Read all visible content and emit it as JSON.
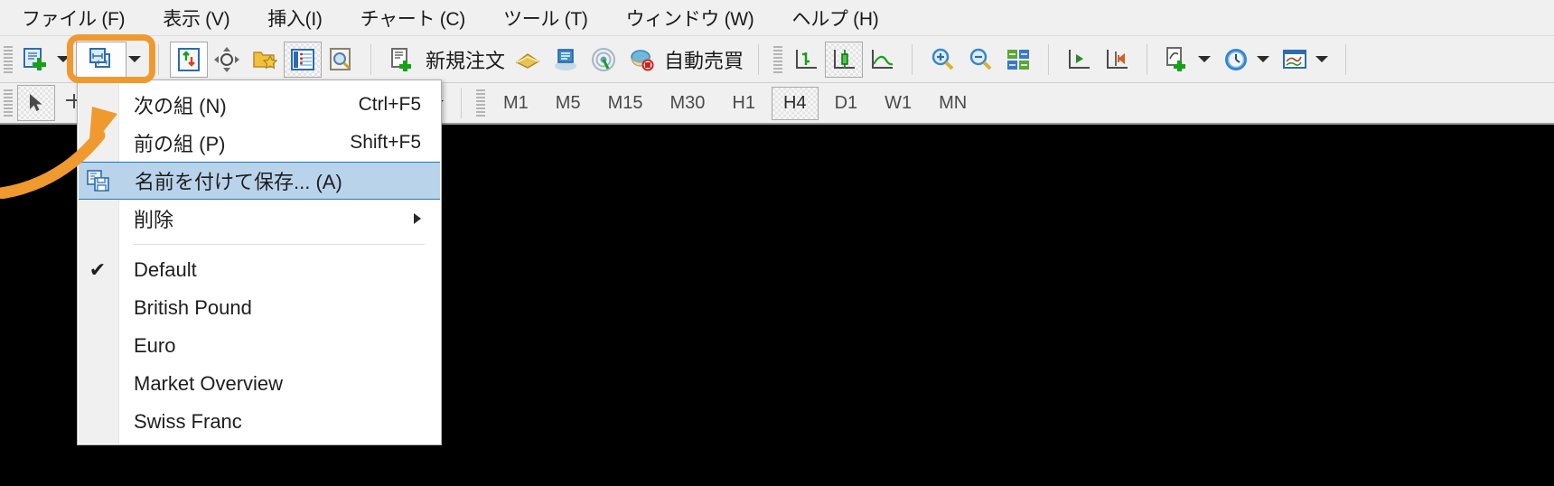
{
  "app": {
    "title": "MetaTrader 4 terminal",
    "accent_color": "#f0992e",
    "menu_highlight_color": "#b9d4ea",
    "chart_background": "#000000",
    "toolbar_background": "#f0f0f0"
  },
  "menubar": {
    "items": [
      {
        "label": "ファイル (F)",
        "name": "menu-file"
      },
      {
        "label": "表示 (V)",
        "name": "menu-view"
      },
      {
        "label": "挿入(I)",
        "name": "menu-insert"
      },
      {
        "label": "チャート (C)",
        "name": "menu-chart"
      },
      {
        "label": "ツール (T)",
        "name": "menu-tools"
      },
      {
        "label": "ウィンドウ (W)",
        "name": "menu-window"
      },
      {
        "label": "ヘルプ (H)",
        "name": "menu-help"
      }
    ]
  },
  "toolbar_main": {
    "buttons": [
      {
        "icon": "new-chart-icon",
        "label": "",
        "dropdown": true
      },
      {
        "icon": "profiles-icon",
        "label": "",
        "dropdown": true,
        "highlighted": true
      },
      {
        "icon": "market-watch-icon",
        "label": ""
      },
      {
        "icon": "crosshair-icon",
        "label": ""
      },
      {
        "icon": "navigator-folder-icon",
        "label": ""
      },
      {
        "icon": "data-window-icon",
        "label": ""
      },
      {
        "icon": "terminal-icon",
        "label": ""
      },
      {
        "icon": "new-order-icon",
        "label": "新規注文"
      },
      {
        "icon": "metaeditor-icon",
        "label": ""
      },
      {
        "icon": "strategy-tester-icon",
        "label": ""
      },
      {
        "icon": "signals-icon",
        "label": ""
      },
      {
        "icon": "autotrading-icon",
        "label": "自動売買"
      },
      {
        "icon": "bar-chart-icon",
        "label": ""
      },
      {
        "icon": "candlestick-chart-icon",
        "label": "",
        "pressed": true
      },
      {
        "icon": "line-chart-icon",
        "label": ""
      },
      {
        "icon": "zoom-in-icon",
        "label": ""
      },
      {
        "icon": "zoom-out-icon",
        "label": ""
      },
      {
        "icon": "tile-windows-icon",
        "label": ""
      },
      {
        "icon": "auto-scroll-icon",
        "label": ""
      },
      {
        "icon": "chart-shift-icon",
        "label": ""
      },
      {
        "icon": "indicators-icon",
        "label": "",
        "dropdown": true
      },
      {
        "icon": "timeframes-clock-icon",
        "label": "",
        "dropdown": true
      },
      {
        "icon": "templates-icon",
        "label": "",
        "dropdown": true
      }
    ]
  },
  "toolbar_secondary": {
    "cursor_button": {
      "icon": "arrow-cursor-icon",
      "pressed": true
    },
    "crosshair_button": {
      "icon": "crosshair-line-icon"
    },
    "objects_button": {
      "icon": "objects-icon",
      "dropdown": true
    },
    "timeframes": [
      {
        "label": "M1",
        "active": false
      },
      {
        "label": "M5",
        "active": false
      },
      {
        "label": "M15",
        "active": false
      },
      {
        "label": "M30",
        "active": false
      },
      {
        "label": "H1",
        "active": false
      },
      {
        "label": "H4",
        "active": true
      },
      {
        "label": "D1",
        "active": false
      },
      {
        "label": "W1",
        "active": false
      },
      {
        "label": "MN",
        "active": false
      }
    ]
  },
  "dropdown_menu": {
    "name": "profiles-dropdown",
    "items": [
      {
        "type": "item",
        "label": "次の組 (N)",
        "accel": "Ctrl+F5",
        "icon": null,
        "checked": false,
        "selected": false,
        "submenu": false
      },
      {
        "type": "item",
        "label": "前の組 (P)",
        "accel": "Shift+F5",
        "icon": null,
        "checked": false,
        "selected": false,
        "submenu": false
      },
      {
        "type": "item",
        "label": "名前を付けて保存... (A)",
        "accel": "",
        "icon": "save-as-icon",
        "checked": false,
        "selected": true,
        "submenu": false
      },
      {
        "type": "item",
        "label": "削除",
        "accel": "",
        "icon": null,
        "checked": false,
        "selected": false,
        "submenu": true
      },
      {
        "type": "separator"
      },
      {
        "type": "item",
        "label": "Default",
        "accel": "",
        "icon": null,
        "checked": true,
        "selected": false,
        "submenu": false
      },
      {
        "type": "item",
        "label": "British Pound",
        "accel": "",
        "icon": null,
        "checked": false,
        "selected": false,
        "submenu": false
      },
      {
        "type": "item",
        "label": "Euro",
        "accel": "",
        "icon": null,
        "checked": false,
        "selected": false,
        "submenu": false
      },
      {
        "type": "item",
        "label": "Market Overview",
        "accel": "",
        "icon": null,
        "checked": false,
        "selected": false,
        "submenu": false
      },
      {
        "type": "item",
        "label": "Swiss Franc",
        "accel": "",
        "icon": null,
        "checked": false,
        "selected": false,
        "submenu": false
      }
    ],
    "check_glyph": "✔"
  },
  "annotation": {
    "highlight_target": "profiles-toolbar-button",
    "arrow_color": "#f0992e",
    "highlight_color": "#f0992e"
  }
}
